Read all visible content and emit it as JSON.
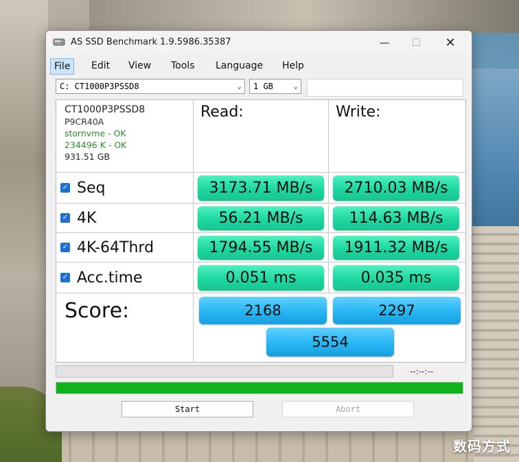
{
  "window": {
    "title": "AS SSD Benchmark 1.9.5986.35387",
    "minimize": "—",
    "maximize": "☐",
    "close": "✕"
  },
  "menu": {
    "items": [
      "File",
      "Edit",
      "View",
      "Tools",
      "Language",
      "Help"
    ],
    "active": "File"
  },
  "drive_select": {
    "value": "C: CT1000P3PSSD8"
  },
  "size_select": {
    "value": "1 GB"
  },
  "drive_info": {
    "model": "CT1000P3PSSD8",
    "firmware": "P9CR40A",
    "driver": "stornvme - OK",
    "alignment": "234496 K - OK",
    "capacity": "931.51 GB"
  },
  "columns": {
    "read": "Read:",
    "write": "Write:"
  },
  "tests": [
    {
      "label": "Seq",
      "checked": true,
      "read": "3173.71 MB/s",
      "write": "2710.03 MB/s"
    },
    {
      "label": "4K",
      "checked": true,
      "read": "56.21 MB/s",
      "write": "114.63 MB/s"
    },
    {
      "label": "4K-64Thrd",
      "checked": true,
      "read": "1794.55 MB/s",
      "write": "1911.32 MB/s"
    },
    {
      "label": "Acc.time",
      "checked": true,
      "read": "0.051 ms",
      "write": "0.035 ms"
    }
  ],
  "score": {
    "label": "Score:",
    "read": "2168",
    "write": "2297",
    "total": "5554"
  },
  "progress": {
    "elapsed": "--:--:--",
    "completed_fraction": 1.0
  },
  "buttons": {
    "start": "Start",
    "abort": "Abort"
  },
  "colors": {
    "result_green": "#1ed7a0",
    "score_blue": "#27b5f3",
    "progress_green": "#10b31a"
  },
  "watermark": "数码方式"
}
